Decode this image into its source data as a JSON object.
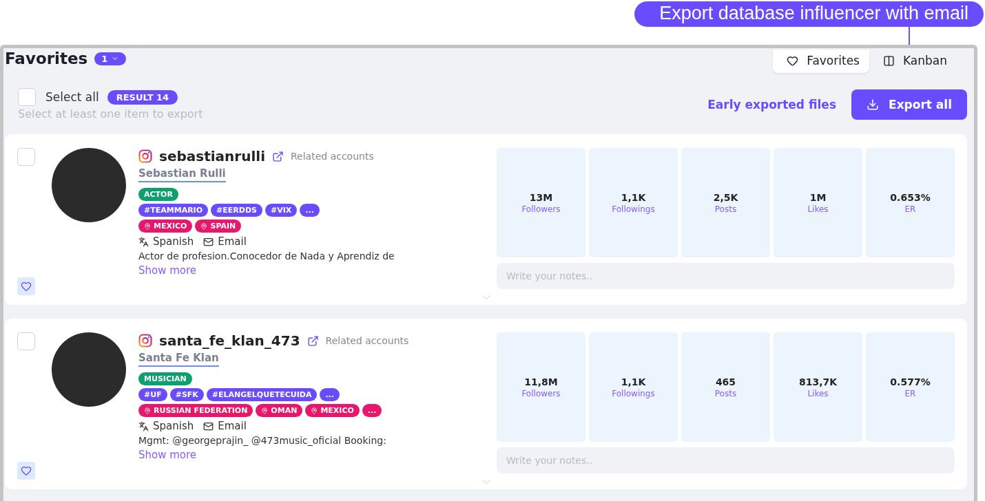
{
  "callout": {
    "text": "Export database influencer with email"
  },
  "header": {
    "title": "Favorites",
    "count_badge": "1",
    "view_tabs": [
      {
        "label": "Favorites",
        "kind": "heart",
        "selected": true
      },
      {
        "label": "Kanban",
        "kind": "kanban",
        "selected": false
      }
    ]
  },
  "toolbar": {
    "select_all": {
      "label": "Select all",
      "checked": false
    },
    "result_badge": "RESULT 14",
    "hint": "Select at least one item to export",
    "early_link": "Early exported files",
    "export_button": "Export all"
  },
  "influencers": [
    {
      "checked": false,
      "handle": "sebastianrulli",
      "related": "Related accounts",
      "name": "Sebastian Rulli",
      "tag_rows": [
        [
          {
            "kind": "category",
            "label": "ACTOR"
          }
        ],
        [
          {
            "kind": "hashtag",
            "label": "#TEAMMARIO"
          },
          {
            "kind": "hashtag",
            "label": "#EERDDS"
          },
          {
            "kind": "hashtag",
            "label": "#VIX"
          },
          {
            "kind": "hashtag",
            "label": "..."
          }
        ],
        [
          {
            "kind": "location",
            "label": "MEXICO"
          },
          {
            "kind": "location",
            "label": "SPAIN"
          }
        ]
      ],
      "language": "Spanish",
      "contact": "Email",
      "bio": "Actor de profesion.Conocedor de Nada y Aprendiz de",
      "show_more": "Show more",
      "stats": [
        {
          "value": "13M",
          "label": "Followers"
        },
        {
          "value": "1,1K",
          "label": "Followings"
        },
        {
          "value": "2,5K",
          "label": "Posts"
        },
        {
          "value": "1M",
          "label": "Likes"
        },
        {
          "value": "0.653%",
          "label": "ER"
        }
      ],
      "notes_placeholder": "Write your notes.."
    },
    {
      "checked": false,
      "handle": "santa_fe_klan_473",
      "related": "Related accounts",
      "name": "Santa Fe Klan",
      "tag_rows": [
        [
          {
            "kind": "category",
            "label": "MUSICIAN"
          }
        ],
        [
          {
            "kind": "hashtag",
            "label": "#UF"
          },
          {
            "kind": "hashtag",
            "label": "#SFK"
          },
          {
            "kind": "hashtag",
            "label": "#ELANGELQUETECUIDA"
          },
          {
            "kind": "hashtag",
            "label": "..."
          }
        ],
        [
          {
            "kind": "location",
            "label": "RUSSIAN FEDERATION"
          },
          {
            "kind": "location",
            "label": "OMAN"
          },
          {
            "kind": "location",
            "label": "MEXICO"
          },
          {
            "kind": "more",
            "label": "..."
          }
        ]
      ],
      "language": "Spanish",
      "contact": "Email",
      "bio": "Mgmt: @georgeprajin_ @473music_oficial Booking:",
      "show_more": "Show more",
      "stats": [
        {
          "value": "11,8M",
          "label": "Followers"
        },
        {
          "value": "1,1K",
          "label": "Followings"
        },
        {
          "value": "465",
          "label": "Posts"
        },
        {
          "value": "813,7K",
          "label": "Likes"
        },
        {
          "value": "0.577%",
          "label": "ER"
        }
      ],
      "notes_placeholder": "Write your notes.."
    }
  ]
}
